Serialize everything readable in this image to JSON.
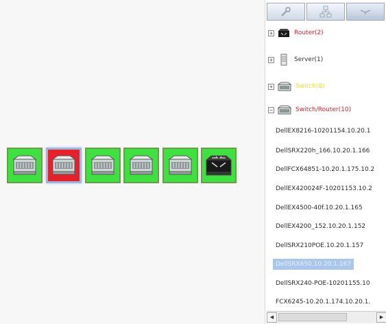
{
  "canvas": {
    "nodes": [
      {
        "icon": "switch-router-icon",
        "color": "#3ee23e",
        "selected": false
      },
      {
        "icon": "switch-router-icon",
        "color": "#e8202a",
        "selected": true
      },
      {
        "icon": "switch-router-icon",
        "color": "#3ee23e",
        "selected": false
      },
      {
        "icon": "switch-router-icon",
        "color": "#3ee23e",
        "selected": false
      },
      {
        "icon": "switch-router-icon",
        "color": "#3ee23e",
        "selected": false
      },
      {
        "icon": "router-icon",
        "color": "#3ee23e",
        "selected": false
      }
    ]
  },
  "panel": {
    "tabs": [
      {
        "icon": "wrench-icon"
      },
      {
        "icon": "topology-icon"
      },
      {
        "icon": "device-icon",
        "active": true
      }
    ],
    "groups": [
      {
        "label": "Router(2)",
        "expander": "+",
        "icon": "router-icon",
        "color": "#e0202a"
      },
      {
        "label": "Server(1)",
        "expander": "+",
        "icon": "server-icon",
        "color": "#333333"
      },
      {
        "label": "Switch(8)",
        "expander": "+",
        "icon": "switch-icon",
        "color": "#f2e21a"
      },
      {
        "label": "Switch/Router(10)",
        "expander": "−",
        "icon": "switch-router-icon",
        "color": "#e0202a"
      }
    ],
    "leaves": [
      "DellEX8216-10201154.10.20.1",
      "DellSRX220h_166.10.20.1.166",
      "DellFCX64851-10.20.1.175.10.2",
      "DellEX420024F-10201153.10.2",
      "DellEX4500-40f.10.20.1.165",
      "DellEX4200_152.10.20.1.152",
      "DellSRX210POE.10.20.1.157",
      "DellSRX650.10.20.1.167",
      "DellSRX240-POE-10201155.10",
      "FCX6245-10.20.1.174.10.20.1."
    ],
    "selected_leaf_index": 7,
    "scroll": {
      "left_label": "◀",
      "right_label": "▶"
    }
  }
}
